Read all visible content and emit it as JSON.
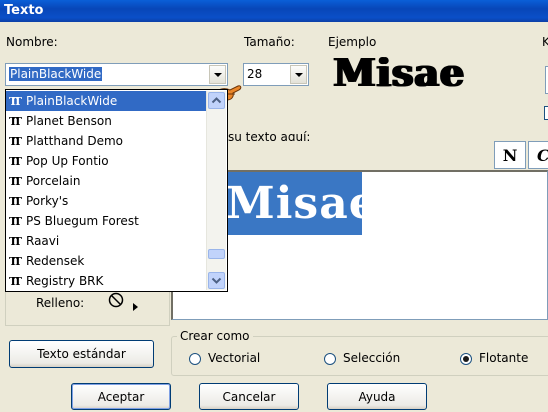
{
  "window": {
    "title": "Texto"
  },
  "font": {
    "label": "Nombre:",
    "value": "PlainBlackWide",
    "list": [
      "PlainBlackWide",
      "Planet Benson",
      "Platthand Demo",
      "Pop Up Fontio",
      "Porcelain",
      "Porky's",
      "PS Bluegum Forest",
      "Raavi",
      "Redensek",
      "Registry BRK"
    ],
    "selected_index": 0
  },
  "size": {
    "label": "Tamaño:",
    "value": "28"
  },
  "sample": {
    "label": "Ejemplo",
    "text": "Misae"
  },
  "text_area": {
    "label_partial": "su texto aquí:",
    "preview_text": "Misae"
  },
  "style_buttons": {
    "bold": "N",
    "italic": "C"
  },
  "fill": {
    "label": "Relleno:"
  },
  "standard_button": "Texto estándar",
  "create_as": {
    "label": "Crear como",
    "options": [
      "Vectorial",
      "Selección",
      "Flotante"
    ],
    "selected": "Flotante"
  },
  "right_partial_label": "K",
  "footer": {
    "ok": "Aceptar",
    "cancel": "Cancelar",
    "help": "Ayuda"
  }
}
